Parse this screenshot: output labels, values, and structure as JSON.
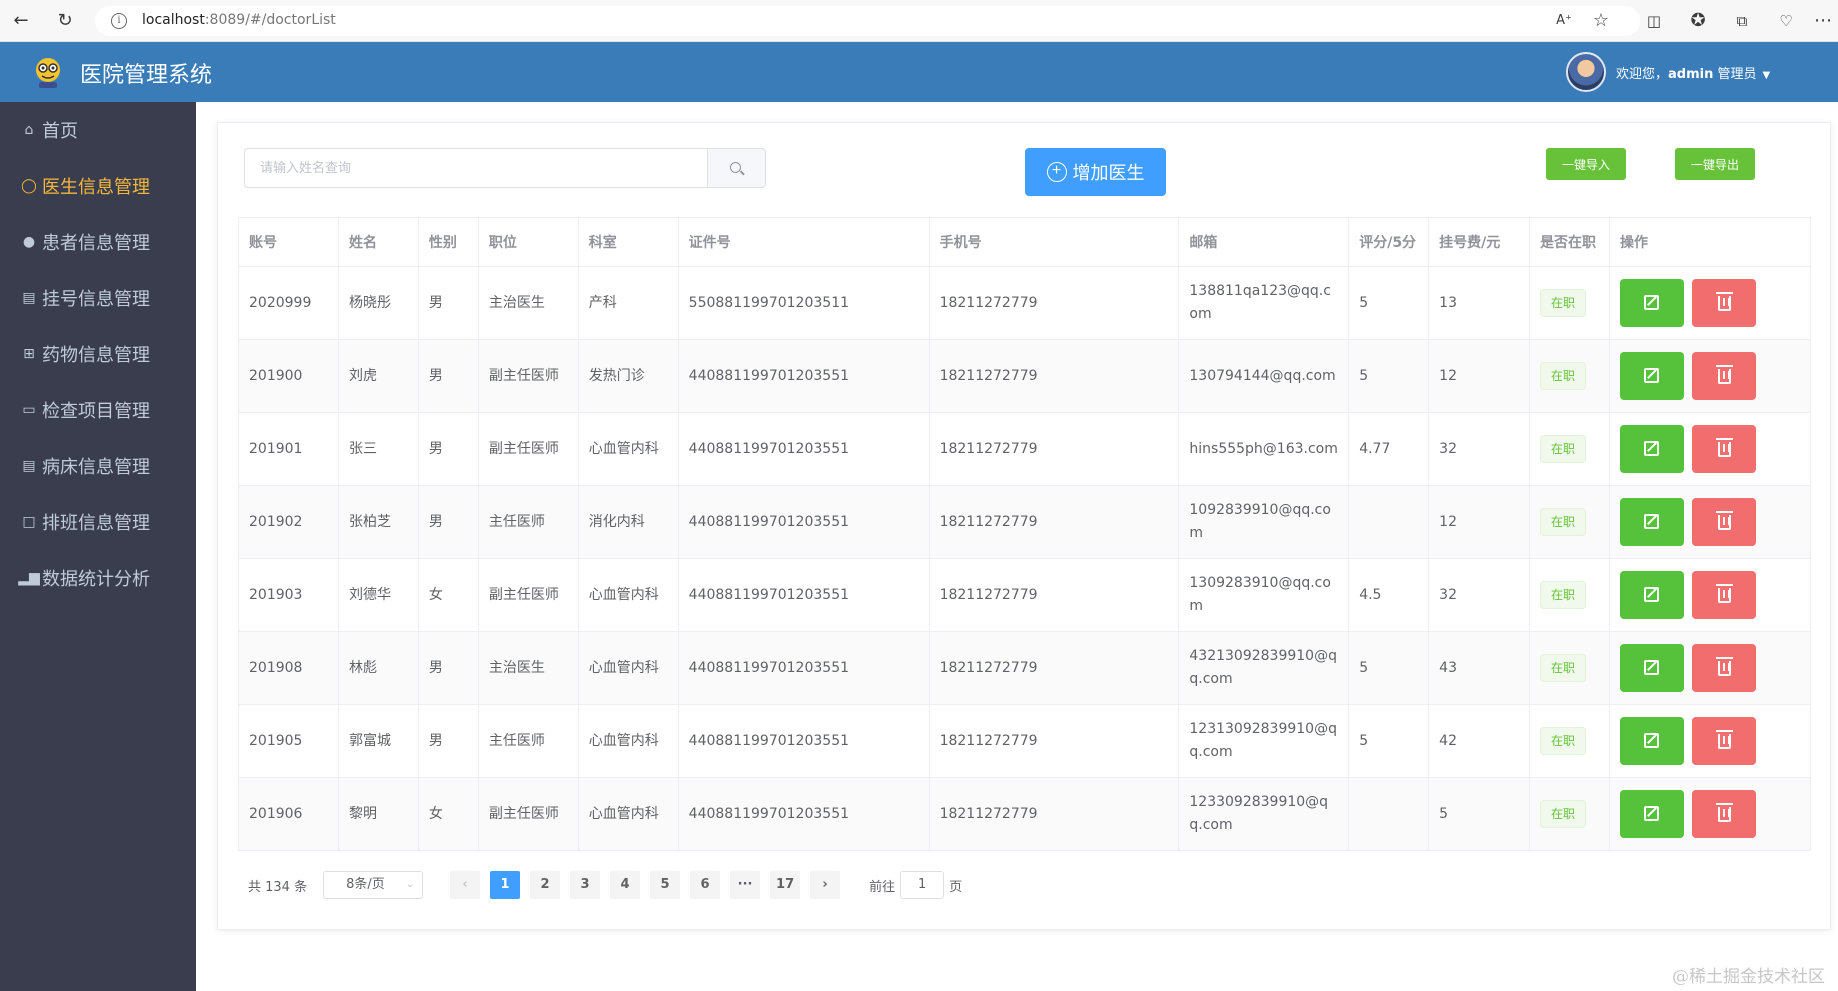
{
  "browser": {
    "url_host": "localhost",
    "url_rest": ":8089/#/doctorList"
  },
  "header": {
    "title": "医院管理系统",
    "welcome_prefix": "欢迎您，",
    "user": "admin",
    "role": "管理员"
  },
  "sidebar": {
    "items": [
      {
        "label": "首页",
        "icon": "home-icon"
      },
      {
        "label": "医生信息管理",
        "icon": "user-outline-icon",
        "active": true
      },
      {
        "label": "患者信息管理",
        "icon": "user-icon"
      },
      {
        "label": "挂号信息管理",
        "icon": "ticket-icon"
      },
      {
        "label": "药物信息管理",
        "icon": "medicine-box-icon"
      },
      {
        "label": "检查项目管理",
        "icon": "monitor-icon"
      },
      {
        "label": "病床信息管理",
        "icon": "document-icon"
      },
      {
        "label": "排班信息管理",
        "icon": "edit-outline-icon"
      },
      {
        "label": "数据统计分析",
        "icon": "bar-chart-icon"
      }
    ]
  },
  "toolbar": {
    "search_placeholder": "请输入姓名查询",
    "add_label": "增加医生",
    "import_label": "一键导入",
    "export_label": "一键导出"
  },
  "table": {
    "columns": [
      "账号",
      "姓名",
      "性别",
      "职位",
      "科室",
      "证件号",
      "手机号",
      "邮箱",
      "评分/5分",
      "挂号费/元",
      "是否在职",
      "操作"
    ],
    "rows": [
      {
        "account": "2020999",
        "name": "杨晓彤",
        "gender": "男",
        "title": "主治医生",
        "dept": "产科",
        "id_no": "550881199701203511",
        "phone": "18211272779",
        "email": "138811qa123@qq.com",
        "score": "5",
        "fee": "13",
        "status": "在职"
      },
      {
        "account": "201900",
        "name": "刘虎",
        "gender": "男",
        "title": "副主任医师",
        "dept": "发热门诊",
        "id_no": "440881199701203551",
        "phone": "18211272779",
        "email": "130794144@qq.com",
        "score": "5",
        "fee": "12",
        "status": "在职"
      },
      {
        "account": "201901",
        "name": "张三",
        "gender": "男",
        "title": "副主任医师",
        "dept": "心血管内科",
        "id_no": "440881199701203551",
        "phone": "18211272779",
        "email": "hins555ph@163.com",
        "score": "4.77",
        "fee": "32",
        "status": "在职"
      },
      {
        "account": "201902",
        "name": "张柏芝",
        "gender": "男",
        "title": "主任医师",
        "dept": "消化内科",
        "id_no": "440881199701203551",
        "phone": "18211272779",
        "email": "1092839910@qq.com",
        "score": "",
        "fee": "12",
        "status": "在职"
      },
      {
        "account": "201903",
        "name": "刘德华",
        "gender": "女",
        "title": "副主任医师",
        "dept": "心血管内科",
        "id_no": "440881199701203551",
        "phone": "18211272779",
        "email": "1309283910@qq.com",
        "score": "4.5",
        "fee": "32",
        "status": "在职"
      },
      {
        "account": "201908",
        "name": "林彪",
        "gender": "男",
        "title": "主治医生",
        "dept": "心血管内科",
        "id_no": "440881199701203551",
        "phone": "18211272779",
        "email": "43213092839910@qq.com",
        "score": "5",
        "fee": "43",
        "status": "在职"
      },
      {
        "account": "201905",
        "name": "郭富城",
        "gender": "男",
        "title": "主任医师",
        "dept": "心血管内科",
        "id_no": "440881199701203551",
        "phone": "18211272779",
        "email": "12313092839910@qq.com",
        "score": "5",
        "fee": "42",
        "status": "在职"
      },
      {
        "account": "201906",
        "name": "黎明",
        "gender": "女",
        "title": "副主任医师",
        "dept": "心血管内科",
        "id_no": "440881199701203551",
        "phone": "18211272779",
        "email": "1233092839910@qq.com",
        "score": "",
        "fee": "5",
        "status": "在职"
      }
    ]
  },
  "pagination": {
    "total": "共 134 条",
    "page_size": "8条/页",
    "pages": [
      "1",
      "2",
      "3",
      "4",
      "5",
      "6",
      "···",
      "17"
    ],
    "current": "1",
    "goto_prefix": "前往",
    "goto_value": "1",
    "goto_suffix": "页"
  },
  "watermark": "@稀土掘金技术社区",
  "colors": {
    "header": "#3a7cb8",
    "sidebar": "#393d4d",
    "active_menu": "#f5b83d",
    "primary": "#409eff",
    "success": "#67c23a",
    "danger": "#f26d6d"
  }
}
